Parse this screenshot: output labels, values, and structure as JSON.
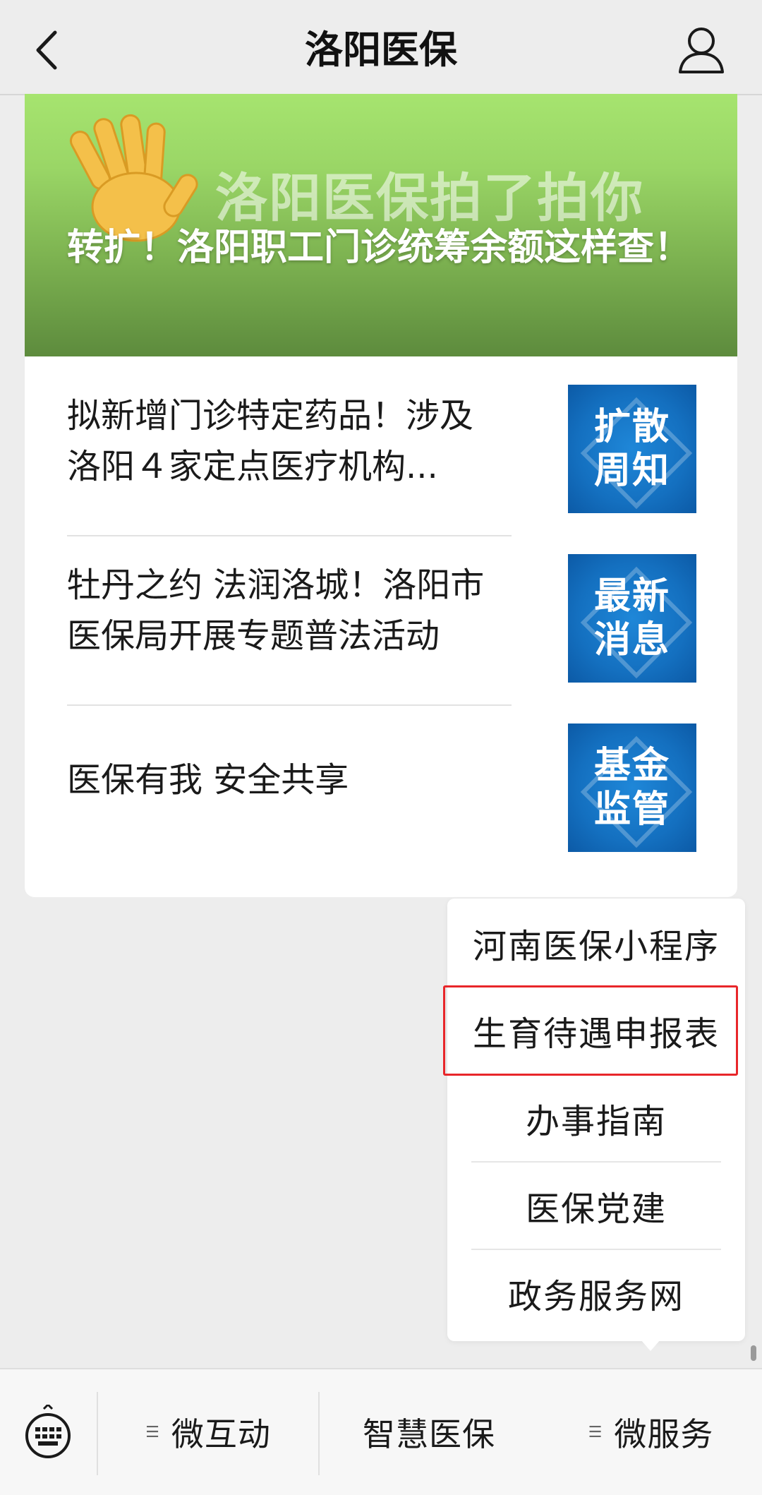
{
  "header": {
    "title": "洛阳医保"
  },
  "hero": {
    "watermark": "洛阳医保拍了拍你",
    "title": "转扩！洛阳职工门诊统筹余额这样查！"
  },
  "articles": [
    {
      "title": "拟新增门诊特定药品！涉及洛阳４家定点医疗机构...",
      "thumb_line1": "扩散",
      "thumb_line2": "周知"
    },
    {
      "title": "牡丹之约 法润洛城！洛阳市医保局开展专题普法活动",
      "thumb_line1": "最新",
      "thumb_line2": "消息"
    },
    {
      "title": "医保有我 安全共享",
      "thumb_line1": "基金",
      "thumb_line2": "监管"
    }
  ],
  "popup_menu": {
    "items": [
      "河南医保小程序",
      "生育待遇申报表",
      "办事指南",
      "医保党建",
      "政务服务网"
    ]
  },
  "bottom_menu": {
    "tabs": [
      "微互动",
      "智慧医保",
      "微服务"
    ],
    "menu_glyph": "☰"
  },
  "colors": {
    "highlight": "#e8262a",
    "thumb_blue": "#1470c0",
    "hero_green": "#9ad666"
  }
}
